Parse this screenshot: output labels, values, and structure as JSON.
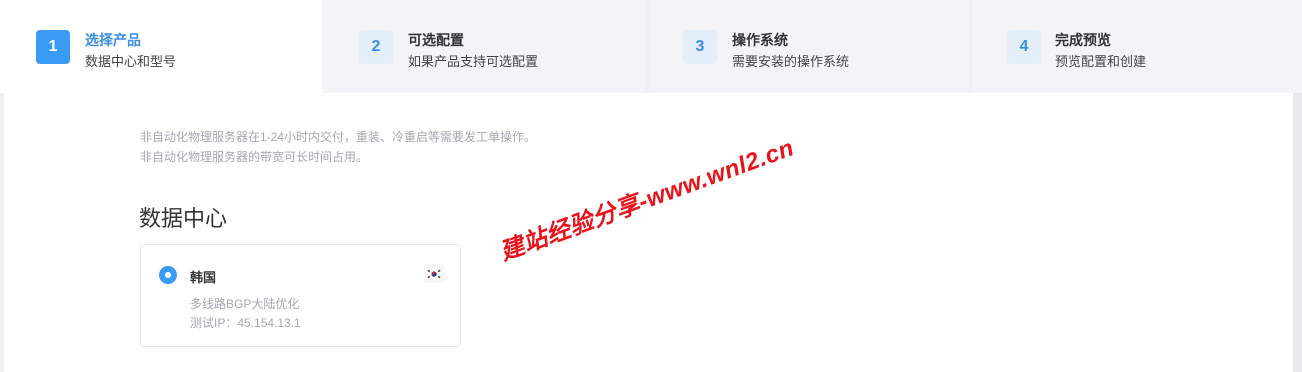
{
  "steps": [
    {
      "num": "1",
      "title": "选择产品",
      "sub": "数据中心和型号",
      "active": true
    },
    {
      "num": "2",
      "title": "可选配置",
      "sub": "如果产品支持可选配置"
    },
    {
      "num": "3",
      "title": "操作系统",
      "sub": "需要安装的操作系统"
    },
    {
      "num": "4",
      "title": "完成预览",
      "sub": "预览配置和创建"
    }
  ],
  "notes": {
    "line1": "非自动化物理服务器在1-24小时内交付，重装、冷重启等需要发工单操作。",
    "line2": "非自动化物理服务器的带宽可长时间占用。"
  },
  "section_title": "数据中心",
  "datacenter": {
    "name": "韩国",
    "flag_icon": "south-korea-flag-icon",
    "desc1": "多线路BGP大陆优化",
    "desc2": "测试IP：45.154.13.1",
    "selected": true
  },
  "watermark": "建站经验分享-www.wnl2.cn",
  "colors": {
    "accent": "#3a9bf5",
    "watermark": "#e8141c"
  }
}
